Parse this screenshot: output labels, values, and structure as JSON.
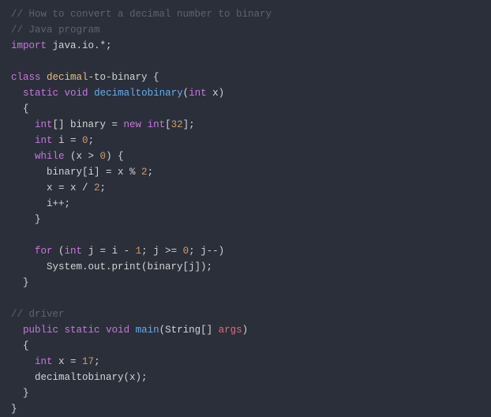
{
  "code": {
    "comment1": "// How to convert a decimal number to binary",
    "comment2": "// Java program",
    "kw_import": "import",
    "pkg": " java.io.*;",
    "kw_class": "class",
    "classname1": " decimal",
    "classname2": "-to-binary {",
    "kw_static": "static",
    "kw_void": "void",
    "method_name": "decimaltobinary",
    "kw_int_param": "int",
    "param_x": " x)",
    "brace_open": "{",
    "kw_int1": "int",
    "arr_decl": "[] binary = ",
    "kw_new": "new",
    "kw_int2": "int",
    "arr_size_open": "[",
    "num_32": "32",
    "arr_size_close": "];",
    "kw_int3": "int",
    "var_i_decl": " i = ",
    "num_0a": "0",
    "semi": ";",
    "kw_while": "while",
    "while_cond_open": " (x > ",
    "num_0b": "0",
    "while_cond_close": ") {",
    "line_binary_assign": "binary[i] = x % ",
    "num_2a": "2",
    "semi2": ";",
    "line_x_div": "x = x / ",
    "num_2b": "2",
    "semi3": ";",
    "line_ipp": "i++;",
    "brace_close1": "}",
    "kw_for": "for",
    "for_open": " (",
    "kw_int4": "int",
    "for_init": " j = i - ",
    "num_1": "1",
    "for_cond": "; j >= ",
    "num_0c": "0",
    "for_iter": "; j--)",
    "sysout": "System.out.print(binary[j]);",
    "brace_close2": "}",
    "comment3": "// driver",
    "kw_public": "public",
    "kw_static2": "static",
    "kw_void2": "void",
    "method_main": "main",
    "main_param_open": "(String[] ",
    "main_args": "args",
    "main_param_close": ")",
    "brace_open2": "{",
    "kw_int5": "int",
    "var_x_decl": " x = ",
    "num_17": "17",
    "semi4": ";",
    "call_method": "decimaltobinary(x);",
    "brace_close3": "}",
    "brace_close4": "}"
  }
}
